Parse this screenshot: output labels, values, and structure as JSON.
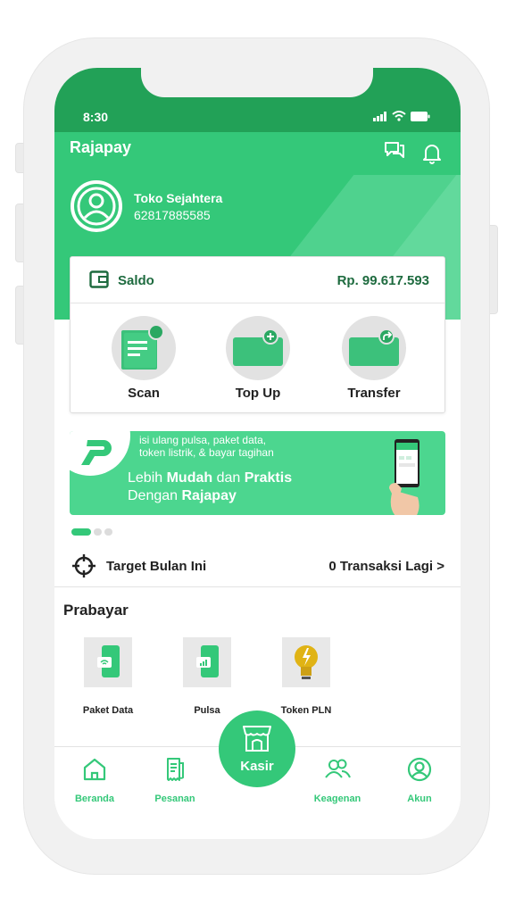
{
  "status_bar": {
    "time": "8:30"
  },
  "header": {
    "app_title": "Rajapay"
  },
  "profile": {
    "name": "Toko Sejahtera",
    "phone": "62817885585"
  },
  "balance": {
    "label": "Saldo",
    "amount": "Rp. 99.617.593"
  },
  "actions": [
    {
      "label": "Scan",
      "icon": "scan-icon"
    },
    {
      "label": "Top Up",
      "icon": "top-up-icon"
    },
    {
      "label": "Transfer",
      "icon": "transfer-icon"
    }
  ],
  "banner": {
    "small_line1": "isi ulang pulsa, paket data,",
    "small_line2": "token listrik, & bayar tagihan",
    "line1_a": "Lebih ",
    "line1_b": "Mudah",
    "line1_c": " dan ",
    "line1_d": "Praktis",
    "line2_a": "Dengan ",
    "line2_b": "Rajapay",
    "active_slide": 1,
    "slide_count": 3
  },
  "target": {
    "label": "Target Bulan Ini",
    "link": "0 Transaksi Lagi >"
  },
  "prabayar": {
    "title": "Prabayar",
    "items": [
      {
        "label": "Paket Data",
        "icon": "paket-data-icon"
      },
      {
        "label": "Pulsa",
        "icon": "pulsa-icon"
      },
      {
        "label": "Token PLN",
        "icon": "lightbulb-icon"
      }
    ]
  },
  "bottom_nav": {
    "items": [
      {
        "label": "Beranda",
        "icon": "home-icon"
      },
      {
        "label": "Pesanan",
        "icon": "receipt-icon"
      },
      {
        "label": "Keagenan",
        "icon": "users-icon"
      },
      {
        "label": "Akun",
        "icon": "account-icon"
      }
    ],
    "center": {
      "label": "Kasir",
      "icon": "store-icon"
    }
  },
  "colors": {
    "primary": "#34c879",
    "status_bar": "#22a157",
    "dark_green_text": "#1e6b3f",
    "banner": "#4cd68f"
  }
}
